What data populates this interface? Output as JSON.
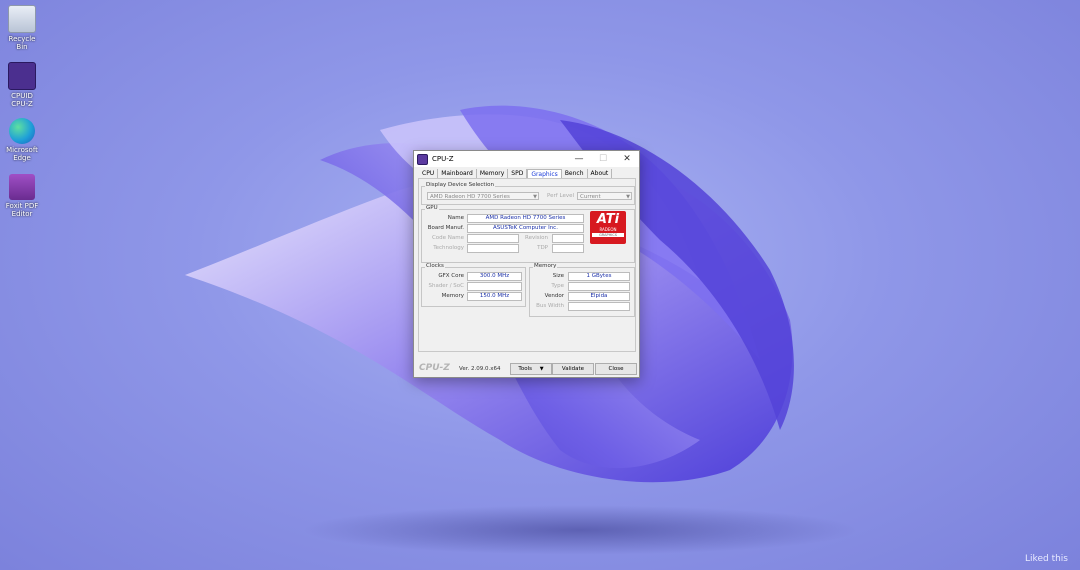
{
  "desktop": {
    "icons": [
      {
        "label": "Recycle Bin",
        "icon": "recycle-bin-icon",
        "color": "#cfd8e6"
      },
      {
        "label": "CPUID CPU-Z",
        "icon": "cpuz-icon",
        "color": "#4b2f8f"
      },
      {
        "label": "Microsoft Edge",
        "icon": "edge-icon",
        "color": "#1fa0d8"
      },
      {
        "label": "Foxit PDF Editor",
        "icon": "foxit-pdf-icon",
        "color": "#7a3b9c"
      }
    ],
    "watermark": "Liked this"
  },
  "window": {
    "title": "CPU-Z",
    "controls": {
      "minimize": "—",
      "maximize": "☐",
      "close": "✕"
    },
    "tabs": [
      "CPU",
      "Mainboard",
      "Memory",
      "SPD",
      "Graphics",
      "Bench",
      "About"
    ],
    "active_tab": "Graphics",
    "display_selection": {
      "legend": "Display Device Selection",
      "device": "AMD Radeon HD 7700 Series",
      "perf_label": "Perf Level",
      "perf_value": "Current"
    },
    "gpu": {
      "legend": "GPU",
      "name_label": "Name",
      "name_value": "AMD Radeon HD 7700 Series",
      "board_label": "Board Manuf.",
      "board_value": "ASUSTeK Computer Inc.",
      "codename_label": "Code Name",
      "codename_value": "",
      "revision_label": "Revision",
      "revision_value": "",
      "technology_label": "Technology",
      "technology_value": "",
      "tdp_label": "TDP",
      "tdp_value": ""
    },
    "logo": {
      "big": "ATi",
      "line1": "RADEON",
      "line2": "GRAPHICS"
    },
    "clocks": {
      "legend": "Clocks",
      "gfx_label": "GFX Core",
      "gfx_value": "300.0 MHz",
      "shader_label": "Shader / SoC",
      "shader_value": "",
      "memory_label": "Memory",
      "memory_value": "150.0 MHz"
    },
    "memory": {
      "legend": "Memory",
      "size_label": "Size",
      "size_value": "1 GBytes",
      "type_label": "Type",
      "type_value": "",
      "vendor_label": "Vendor",
      "vendor_value": "Elpida",
      "buswidth_label": "Bus Width",
      "buswidth_value": ""
    },
    "footer": {
      "brand": "CPU-Z",
      "version": "Ver. 2.09.0.x64",
      "tools_label": "Tools",
      "validate_label": "Validate",
      "close_label": "Close"
    }
  }
}
